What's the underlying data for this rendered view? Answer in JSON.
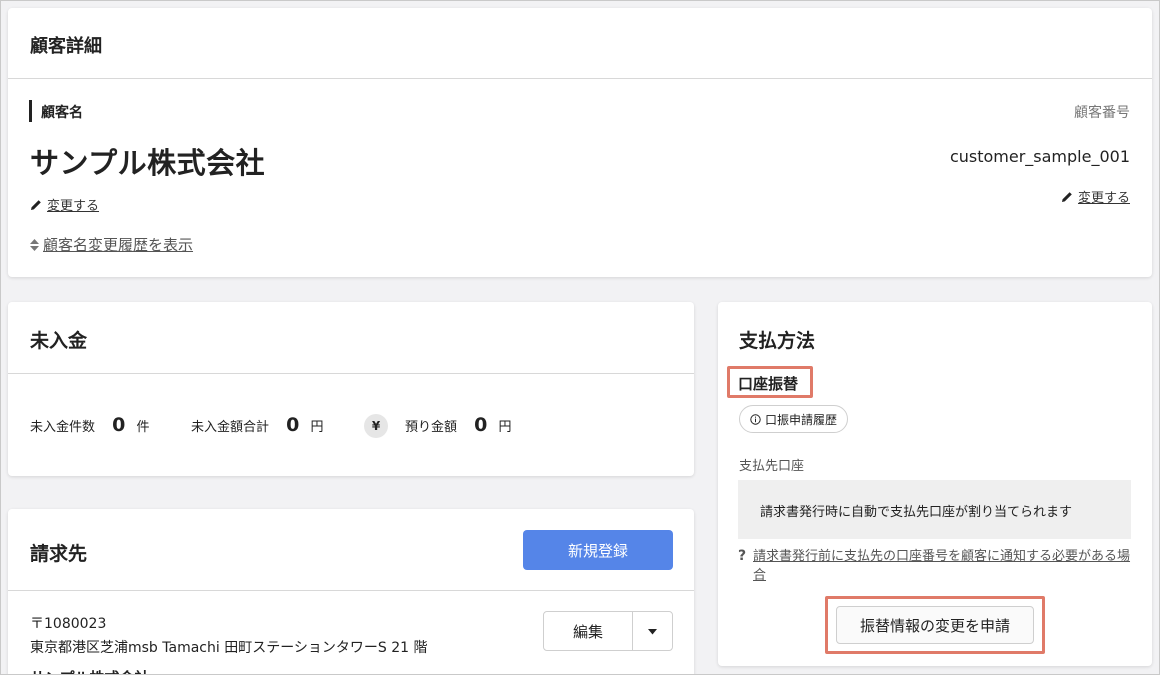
{
  "customer_detail": {
    "title": "顧客詳細",
    "name_label": "顧客名",
    "name_value": "サンプル株式会社",
    "edit_name_label": "変更する",
    "history_link": "顧客名変更履歴を表示",
    "number_label": "顧客番号",
    "number_value": "customer_sample_001",
    "edit_number_label": "変更する"
  },
  "unpaid": {
    "title": "未入金",
    "count_label": "未入金件数",
    "count_value": "0",
    "count_unit": "件",
    "total_label": "未入金額合計",
    "total_value": "0",
    "total_unit": "円",
    "yen_icon": "¥",
    "deposit_label": "預り金額",
    "deposit_value": "0",
    "deposit_unit": "円"
  },
  "billing": {
    "title": "請求先",
    "new_button": "新規登録",
    "postal": "〒1080023",
    "address": "東京都港区芝浦msb Tamachi 田町ステーションタワーS 21 階",
    "edit_button": "編集",
    "truncated_name": "サンプル株式会社"
  },
  "payment": {
    "title": "支払方法",
    "method": "口座振替",
    "history_button": "口振申請履歴",
    "account_label": "支払先口座",
    "account_info": "請求書発行時に自動で支払先口座が割り当てられます",
    "notice_link": "請求書発行前に支払先の口座番号を顧客に通知する必要がある場合",
    "change_button": "振替情報の変更を申請"
  },
  "colors": {
    "primary": "#5585e8",
    "highlight": "#e07a68",
    "page_bg": "#f2f2f4"
  }
}
